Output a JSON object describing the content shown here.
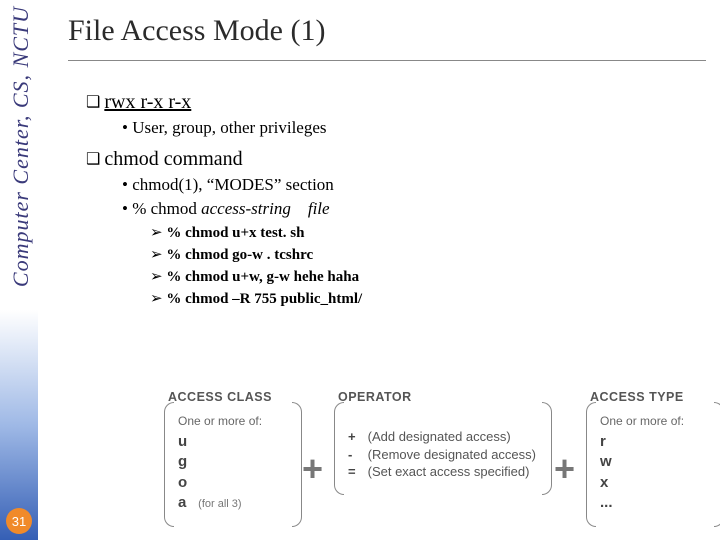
{
  "sidebar": {
    "label": "Computer Center, CS, NCTU"
  },
  "page_number": "31",
  "title": "File Access Mode (1)",
  "bullets": {
    "perm_string": "rwx r-x r-x",
    "perm_sub": "User, group, other privileges",
    "chmod_title": "chmod command",
    "chmod_man": "chmod(1),",
    "modes_lq": "“",
    "modes_word": "MODES",
    "modes_rq": "”",
    "modes_tail": " section",
    "usage_prefix": "% chmod ",
    "usage_arg1": "access-string",
    "usage_arg2": "file",
    "examples": [
      "% chmod u+x test. sh",
      "% chmod go-w . tcshrc",
      "% chmod u+w, g-w hehe haha",
      "% chmod –R 755 public_html/"
    ]
  },
  "diagram": {
    "col1": {
      "label": "ACCESS CLASS",
      "sub": "One or more of:",
      "rows": [
        "u",
        "g",
        "o"
      ],
      "extra_sym": "a",
      "extra_note": "(for all 3)"
    },
    "plus": "+",
    "col2": {
      "label": "OPERATOR",
      "rows": [
        {
          "sym": "+",
          "desc": "(Add designated access)"
        },
        {
          "sym": "-",
          "desc": "(Remove designated access)"
        },
        {
          "sym": "=",
          "desc": "(Set exact access specified)"
        }
      ]
    },
    "col3": {
      "label": "ACCESS TYPE",
      "sub": "One or more of:",
      "rows": [
        "r",
        "w",
        "x",
        "..."
      ]
    }
  }
}
